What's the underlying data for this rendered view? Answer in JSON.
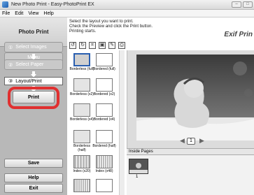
{
  "window": {
    "title": "New Photo Print - Easy-PhotoPrint EX"
  },
  "menu": [
    "File",
    "Edit",
    "View",
    "Help"
  ],
  "sidebar": {
    "header": "Photo Print",
    "menu_label": "Menu",
    "steps": [
      {
        "num": "①",
        "label": "Select Images"
      },
      {
        "num": "②",
        "label": "Select Paper"
      },
      {
        "num": "③",
        "label": "Layout/Print"
      }
    ],
    "print_label": "Print",
    "save_label": "Save",
    "help_label": "Help",
    "exit_label": "Exit"
  },
  "instructions": [
    "Select the layout you want to print.",
    "Check the Preview and click the Print button.",
    "Printing starts."
  ],
  "logo": "Exif Prin",
  "toolbar": {
    "icons": [
      "rotate-left-icon",
      "rotate-right-icon",
      "crop-icon",
      "image-correct-icon",
      "settings-icon",
      "print-icon"
    ]
  },
  "layouts": [
    {
      "label": "Borderless (full)"
    },
    {
      "label": "Bordered (full)"
    },
    {
      "label": "Borderless (x2)"
    },
    {
      "label": "Bordered (x2)"
    },
    {
      "label": "Borderless (x4)"
    },
    {
      "label": "Bordered (x4)"
    },
    {
      "label": "Borderless (half)"
    },
    {
      "label": "Bordered (half)"
    },
    {
      "label": "Index (x20)"
    },
    {
      "label": "Index (x48)"
    }
  ],
  "preview": {
    "page": "1"
  },
  "inside_pages": {
    "header": "Inside Pages",
    "pages": [
      "1"
    ]
  }
}
